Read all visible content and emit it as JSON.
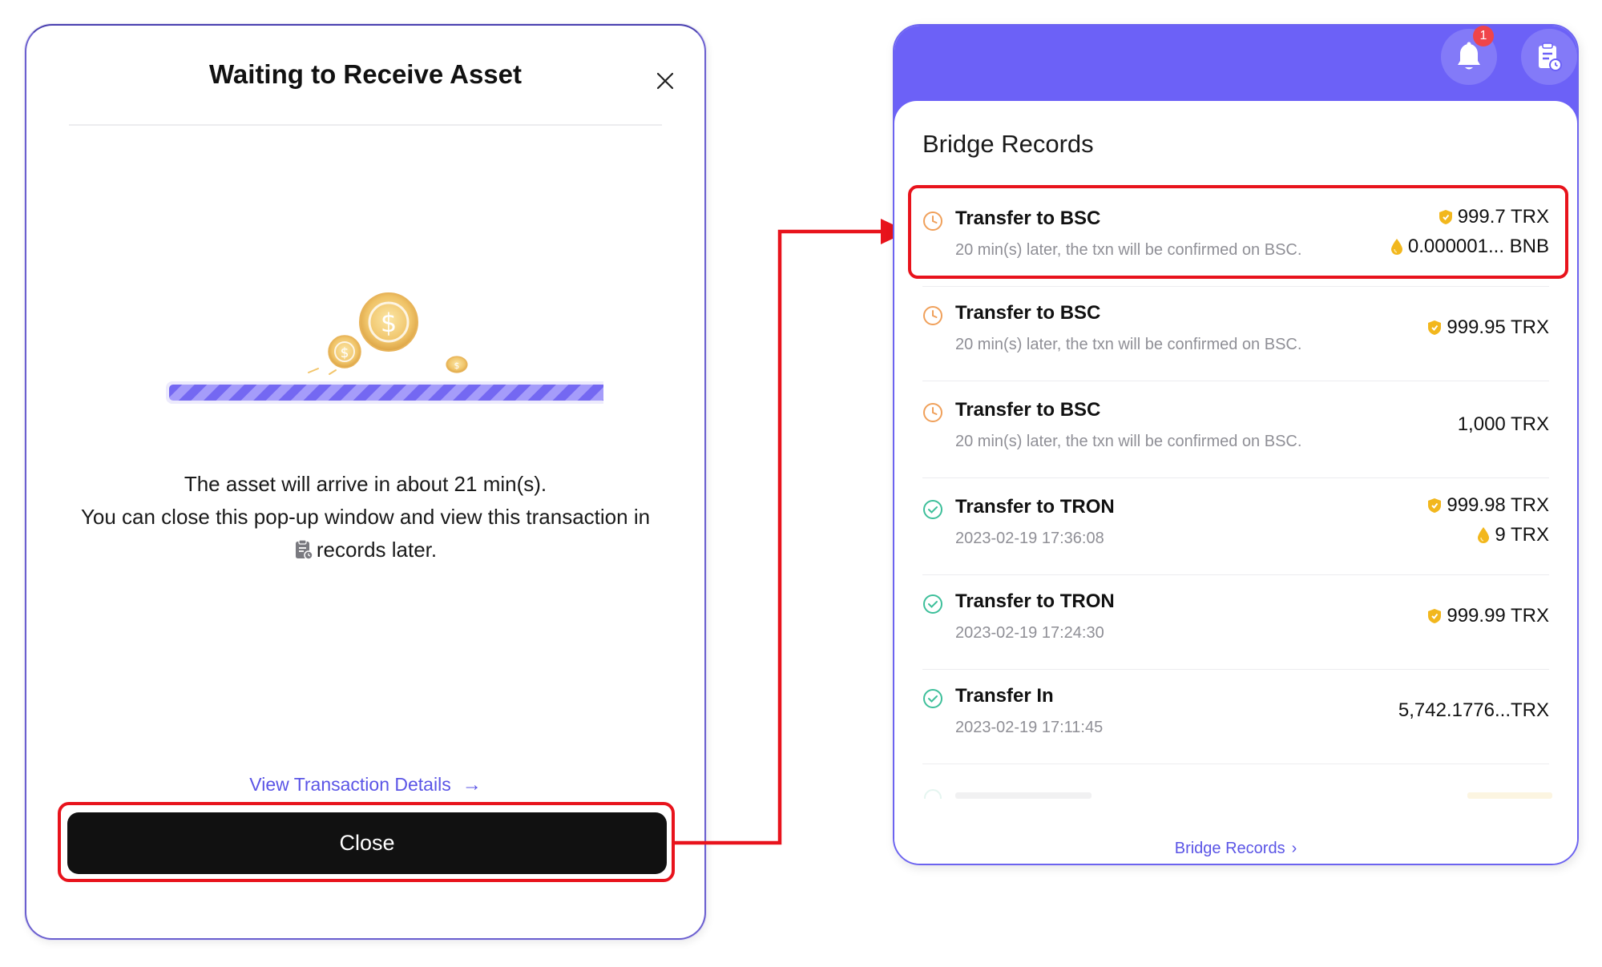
{
  "modal": {
    "title": "Waiting to Receive Asset",
    "message_line1": "The asset will arrive in about 21 min(s).",
    "message_line2": "You can close this pop-up window and view this transaction in",
    "message_line3": "records later.",
    "view_details_label": "View Transaction Details",
    "close_label": "Close"
  },
  "panel": {
    "notification_count": "1",
    "title": "Bridge Records",
    "footer_link": "Bridge Records",
    "records": [
      {
        "title": "Transfer to BSC",
        "subtitle": "20 min(s) later, the txn will be confirmed on BSC.",
        "status": "pending",
        "amount1": "999.7 TRX",
        "amount1_icon": "shield-icon",
        "amount2": "0.000001... BNB",
        "amount2_icon": "drop-icon"
      },
      {
        "title": "Transfer to BSC",
        "subtitle": "20 min(s) later, the txn will be confirmed on BSC.",
        "status": "pending",
        "amount1": "999.95 TRX",
        "amount1_icon": "shield-icon"
      },
      {
        "title": "Transfer to BSC",
        "subtitle": "20 min(s) later, the txn will be confirmed on BSC.",
        "status": "pending",
        "amount1": "1,000 TRX"
      },
      {
        "title": "Transfer to TRON",
        "subtitle": "2023-02-19 17:36:08",
        "status": "completed",
        "amount1": "999.98 TRX",
        "amount1_icon": "shield-icon",
        "amount2": "9 TRX",
        "amount2_icon": "drop-icon"
      },
      {
        "title": "Transfer to TRON",
        "subtitle": "2023-02-19 17:24:30",
        "status": "completed",
        "amount1": "999.99 TRX",
        "amount1_icon": "shield-icon"
      },
      {
        "title": "Transfer In",
        "subtitle": "2023-02-19 17:11:45",
        "status": "completed",
        "amount1": "5,742.1776...TRX"
      }
    ]
  },
  "colors": {
    "accent": "#6c61f7",
    "highlight": "#e8131c",
    "pending": "#f0a05a",
    "completed": "#3dbf9a",
    "link": "#5b55e6"
  }
}
